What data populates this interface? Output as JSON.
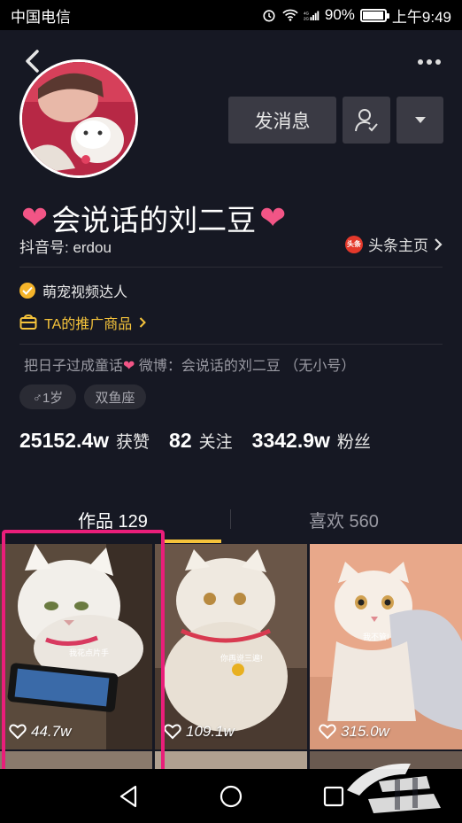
{
  "status_bar": {
    "carrier": "中国电信",
    "battery": "90%",
    "battery_level": 0.9,
    "time": "上午9:49"
  },
  "profile": {
    "nickname": "会说话的刘二豆",
    "douyin_id": "抖音号: erdou",
    "toutiao_logo_text": "头条",
    "toutiao_link": "头条主页",
    "verification": "萌宠视频达人",
    "promo": "TA的推广商品",
    "bio_part1": "把日子过成童话",
    "bio_part2": "微博：会说话的刘二豆 （无小号）",
    "tags": [
      "♂1岁",
      "双鱼座"
    ]
  },
  "buttons": {
    "message": "发消息"
  },
  "stats": {
    "likes_num": "25152.4w",
    "likes_label": "获赞",
    "following_num": "82",
    "following_label": "关注",
    "followers_num": "3342.9w",
    "followers_label": "粉丝"
  },
  "tabs": {
    "works": "作品 129",
    "likes": "喜欢 560"
  },
  "videos": [
    {
      "likes": "44.7w",
      "caption": "我花点片手"
    },
    {
      "likes": "109.1w",
      "caption": "你再说三遍!"
    },
    {
      "likes": "315.0w",
      "caption": "我不管!"
    }
  ],
  "colors": {
    "background": "#161823",
    "accent_yellow": "#f5c33b",
    "heart_pink": "#f25586",
    "highlight": "#e91e7a"
  },
  "icons": [
    "back-icon",
    "more-icon",
    "follow-user-icon",
    "dropdown-icon",
    "verified-icon",
    "shop-icon",
    "chevron-right-icon",
    "heart-outline-icon",
    "nav-back-icon",
    "nav-home-icon",
    "nav-recents-icon"
  ]
}
